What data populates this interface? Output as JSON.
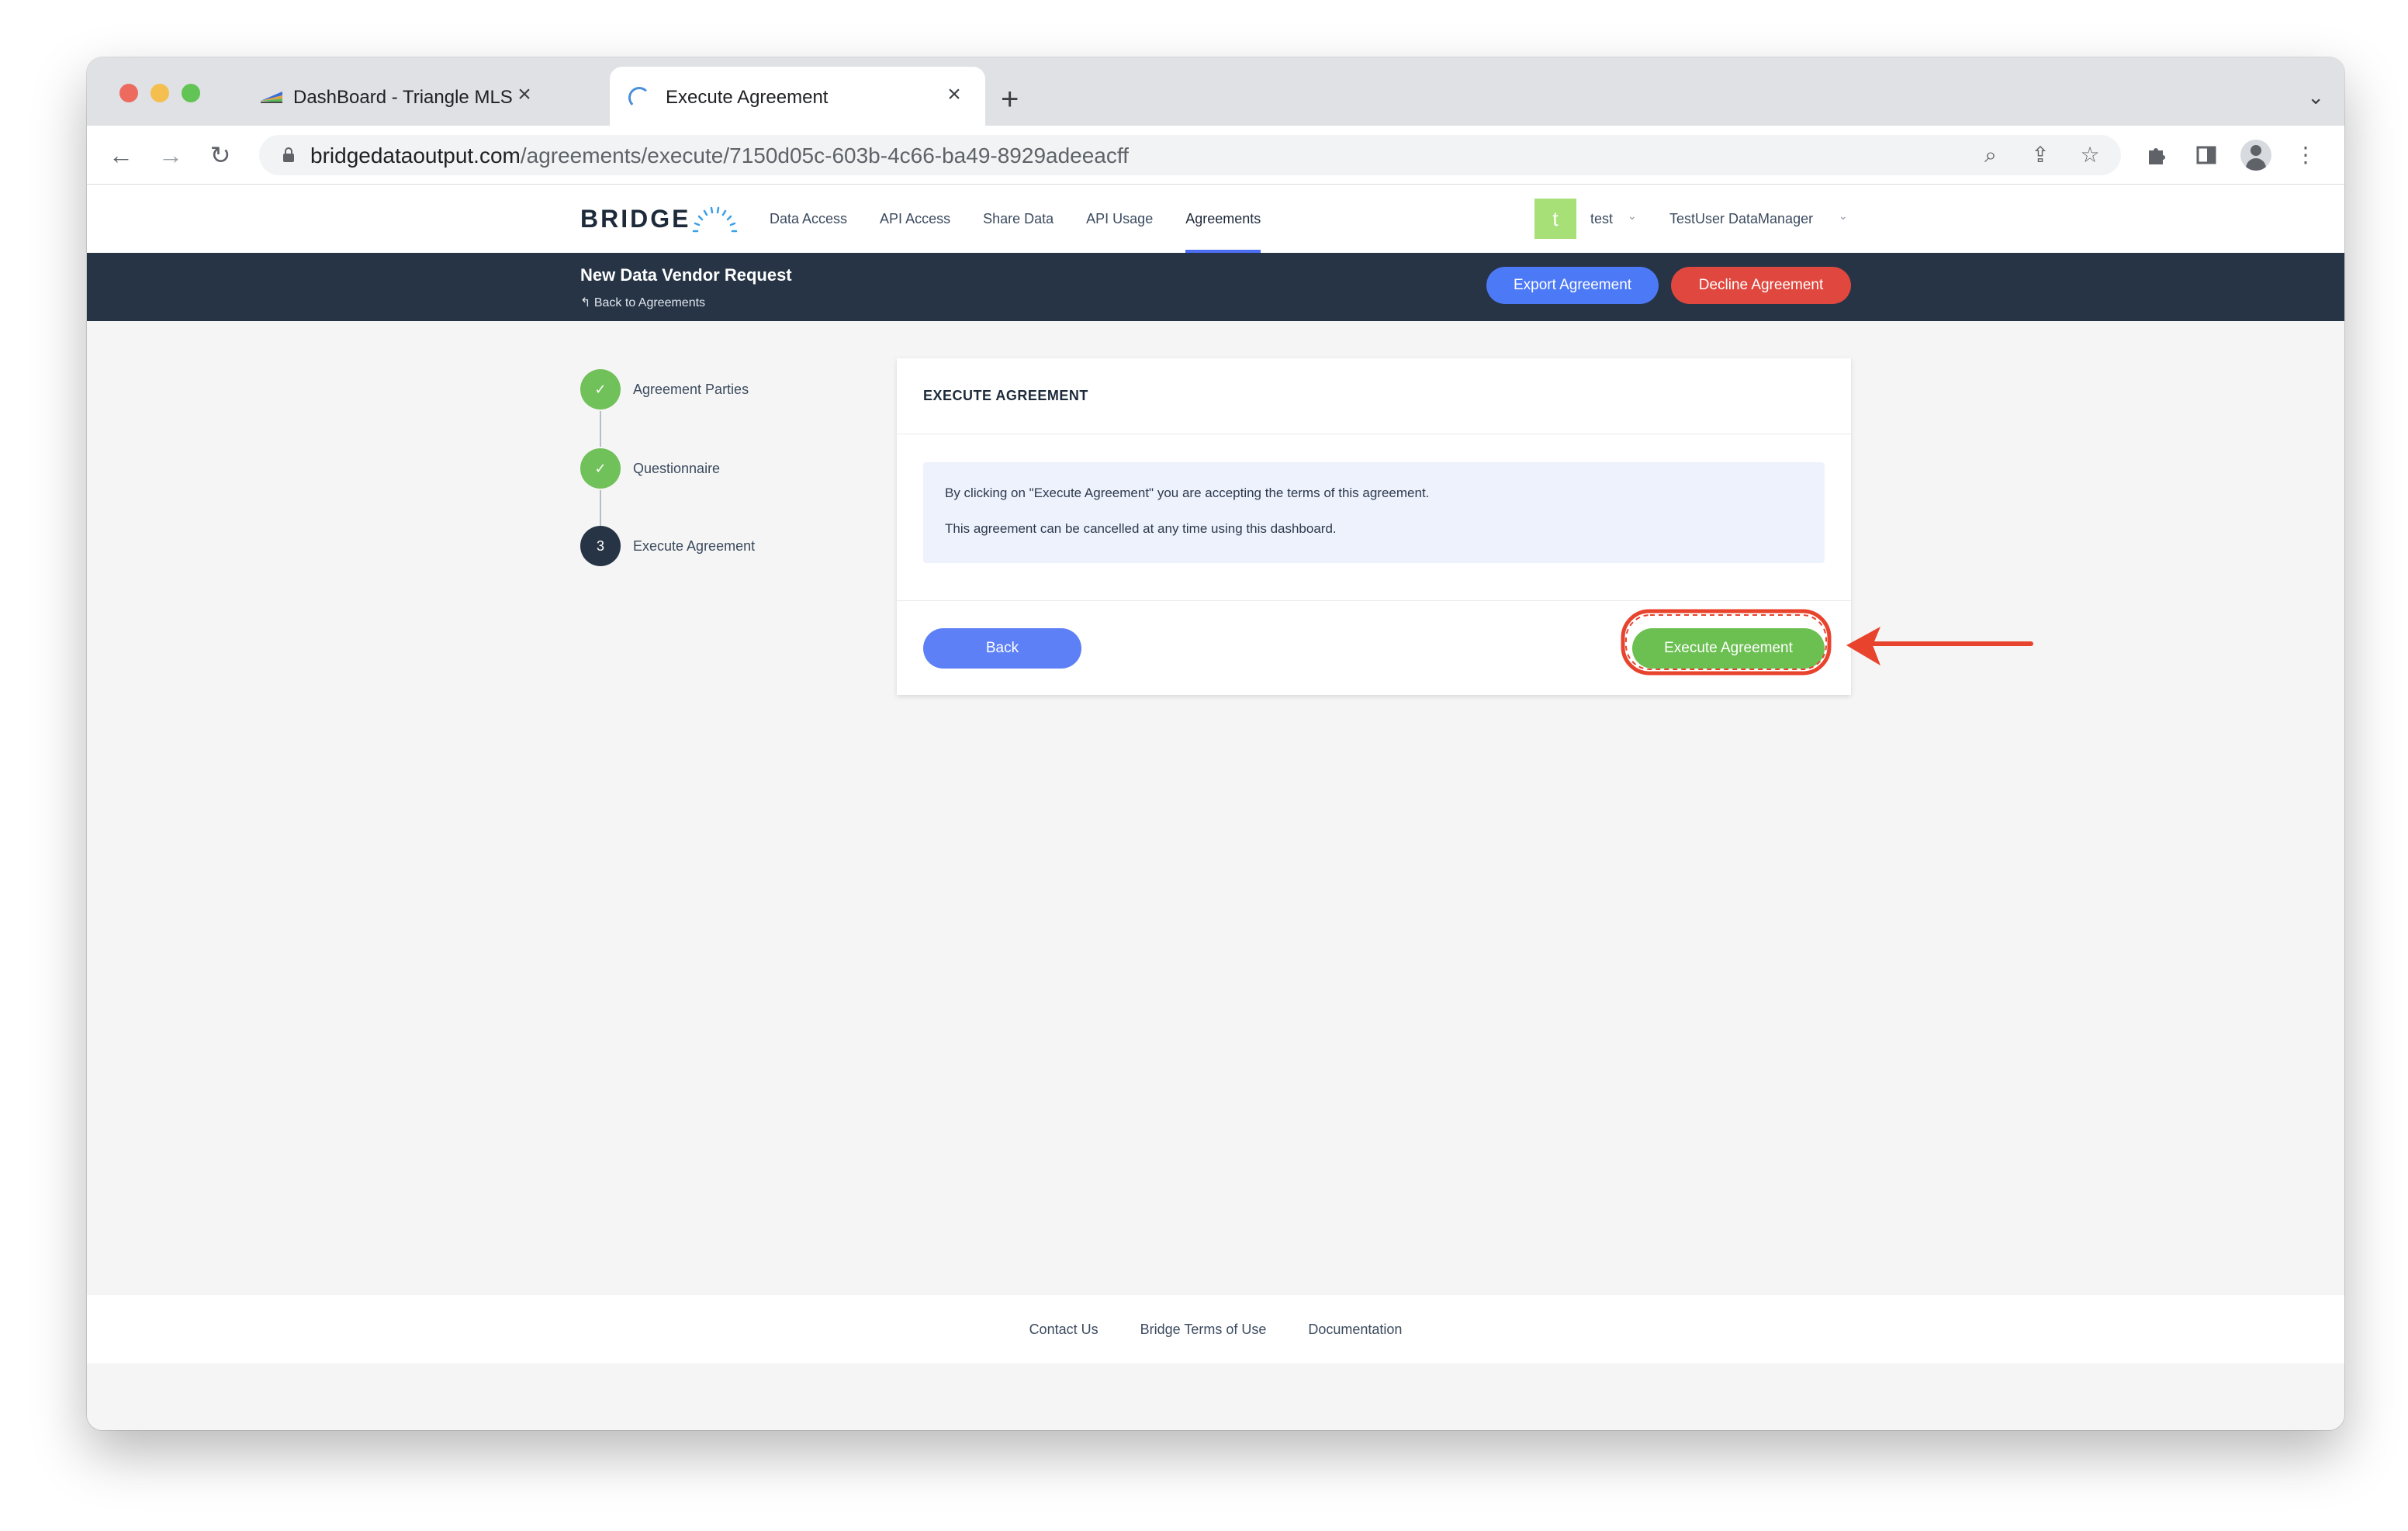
{
  "browser": {
    "tabs": [
      {
        "title": "DashBoard - Triangle MLS",
        "active": false
      },
      {
        "title": "Execute Agreement",
        "active": true
      }
    ],
    "new_tab_icon": "plus-icon",
    "tab_list_icon": "chevron-down-icon",
    "url_host": "bridgedataoutput.com",
    "url_path": "/agreements/execute/7150d05c-603b-4c66-ba49-8929adeeacff"
  },
  "site": {
    "logo": "BRIDGE",
    "nav": [
      {
        "label": "Data Access",
        "active": false
      },
      {
        "label": "API Access",
        "active": false
      },
      {
        "label": "Share Data",
        "active": false
      },
      {
        "label": "API Usage",
        "active": false
      },
      {
        "label": "Agreements",
        "active": true
      }
    ],
    "user": {
      "initial": "t",
      "name": "test",
      "account": "TestUser DataManager"
    }
  },
  "subheader": {
    "title": "New Data Vendor Request",
    "back_link": "Back to Agreements",
    "export_label": "Export Agreement",
    "decline_label": "Decline Agreement"
  },
  "steps": [
    {
      "marker": "✓",
      "label": "Agreement Parties",
      "status": "done"
    },
    {
      "marker": "✓",
      "label": "Questionnaire",
      "status": "done"
    },
    {
      "marker": "3",
      "label": "Execute Agreement",
      "status": "current"
    }
  ],
  "card": {
    "title": "EXECUTE AGREEMENT",
    "notice_lines": [
      "By clicking on \"Execute Agreement\" you are accepting the terms of this agreement.",
      "This agreement can be cancelled at any time using this dashboard."
    ],
    "back_label": "Back",
    "execute_label": "Execute Agreement"
  },
  "footer": {
    "links": [
      "Contact Us",
      "Bridge Terms of Use",
      "Documentation"
    ]
  },
  "colors": {
    "accent_blue": "#4c79f6",
    "decline_red": "#e0473e",
    "execute_green": "#6cc052",
    "header_navy": "#263445",
    "annotation_red": "#e8432d"
  }
}
